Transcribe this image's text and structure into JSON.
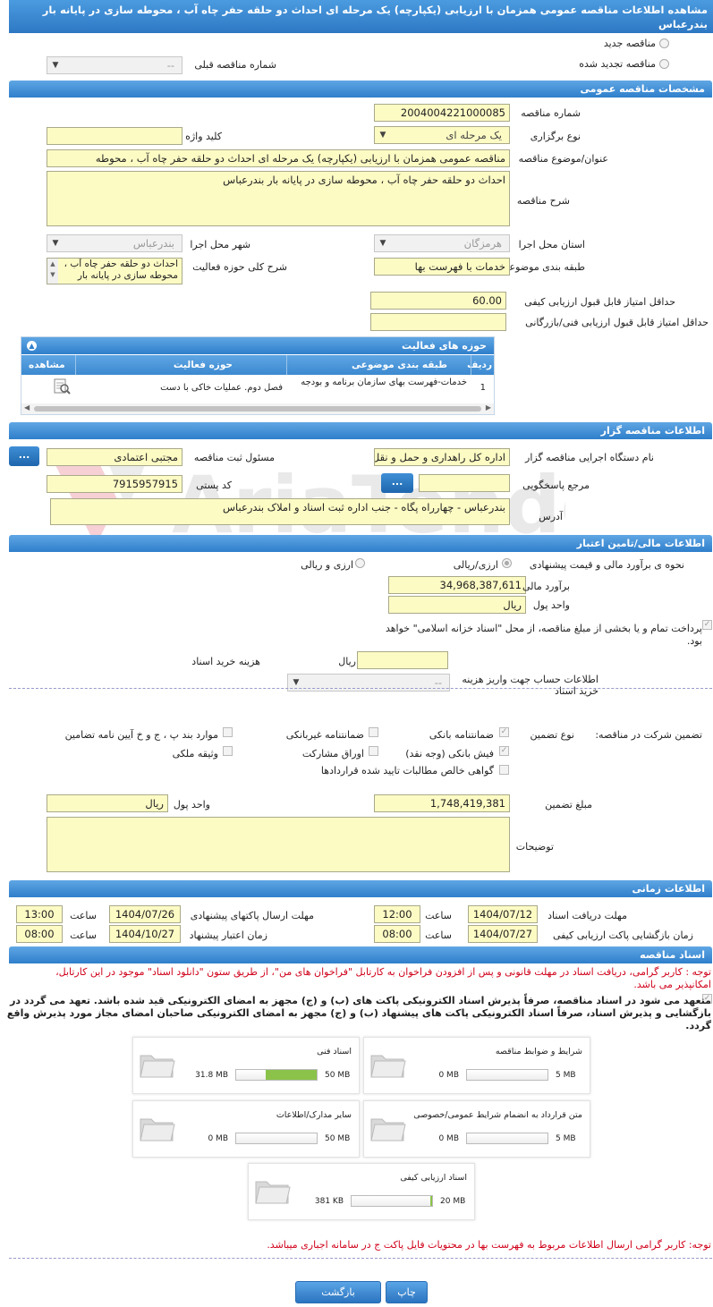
{
  "title": "مشاهده اطلاعات مناقصه عمومی همزمان با ارزیابی (یکپارچه) یک مرحله ای احداث دو حلقه حفر چاه آب ، محوطه سازی در پایانه بار بندرعباس",
  "header": {
    "radio_new": "مناقصه جدید",
    "radio_renewed": "مناقصه تجدید شده",
    "prev_number_label": "شماره مناقصه قبلی",
    "prev_number_value": "--"
  },
  "general": {
    "section_title": "مشخصات مناقصه عمومی",
    "number_label": "شماره مناقصه",
    "number_value": "2004004221000085",
    "type_label": "نوع برگزاری",
    "type_value": "یک مرحله ای",
    "keyword_label": "کلید واژه",
    "keyword_value": "",
    "subject_label": "عنوان/موضوع مناقصه",
    "subject_value": "مناقصه عمومی همزمان با ارزیابی (یکپارچه) یک مرحله ای احداث دو حلقه حفر چاه آب ، محوطه",
    "desc_label": "شرح مناقصه",
    "desc_value": "احداث دو حلقه حفر چاه آب ، محوطه سازی در پایانه بار بندرعباس",
    "province_label": "استان محل اجرا",
    "province_value": "هرمزگان",
    "city_label": "شهر محل اجرا",
    "city_value": "بندرعباس",
    "category_label": "طبقه بندی موضوعی",
    "category_value": "خدمات با فهرست بها",
    "scope_label": "شرح کلی حوزه فعالیت",
    "scope_value": "احداث دو حلقه حفر چاه آب ، محوطه سازی در پایانه بار",
    "min_quality_label": "حداقل امتیاز قابل قبول ارزیابی کیفی",
    "min_quality_value": "60.00",
    "min_tech_label": "حداقل امتیاز قابل قبول ارزیابی فنی/بازرگانی",
    "min_tech_value": ""
  },
  "activity": {
    "title": "حوزه های فعالیت",
    "columns": [
      "ردیف",
      "طبقه بندی موضوعی",
      "حوزه فعالیت",
      "مشاهده"
    ],
    "rows": [
      {
        "num": "1",
        "category": "خدمات-فهرست بهای سازمان برنامه و بودجه",
        "field": "فصل دوم. عملیات خاکی با دست"
      }
    ]
  },
  "organizer": {
    "section_title": "اطلاعات مناقصه گزار",
    "org_label": "نام دستگاه اجرایی مناقصه گزار",
    "org_value": "اداره کل راهداری و حمل و نقل",
    "resp_label": "مسئول ثبت مناقصه",
    "resp_value": "مجتبی اعتمادی",
    "btn_dots": "...",
    "ref_label": "مرجع پاسخگویی",
    "ref_value": "",
    "postal_label": "کد پستی",
    "postal_value": "7915957915",
    "address_label": "آدرس",
    "address_value": "بندرعباس - چهارراه پگاه - جنب اداره ثبت اسناد و املاک بندرعباس"
  },
  "finance": {
    "section_title": "اطلاعات مالی/تامین اعتبار",
    "estimate_method_label": "نحوه ی برآورد مالی و قیمت پیشنهادی",
    "opt_currency": "ارزی/ریالی",
    "opt_currency2": "ارزی و ریالی",
    "estimate_label": "برآورد مالی",
    "estimate_value": "34,968,387,611",
    "unit_label": "واحد پول",
    "unit_value": "ریال",
    "payment_text": "پرداخت تمام و یا بخشی از مبلغ مناقصه، از محل \"اسناد خزانه اسلامی\" خواهد بود.",
    "doc_cost_label": "هزینه خرید اسناد",
    "doc_cost_unit": "ریال",
    "account_label": "اطلاعات حساب جهت واریز هزینه خرید اسناد",
    "account_value": "--"
  },
  "guarantee": {
    "label": "تضمین شرکت در مناقصه:",
    "type_label": "نوع تضمین",
    "options": {
      "bank": "ضمانتنامه بانکی",
      "nonbank": "ضمانتنامه غیربانکی",
      "items": "موارد بند پ ، ج و خ آیین نامه تضامین",
      "cash": "فیش بانکی (وجه نقد)",
      "bonds": "اوراق مشارکت",
      "property": "وثیقه ملکی",
      "cert": "گواهی خالص مطالبات تایید شده قراردادها"
    },
    "amount_label": "مبلغ تضمین",
    "amount_value": "1,748,419,381",
    "unit_label": "واحد پول",
    "unit_value": "ریال",
    "notes_label": "توضیحات"
  },
  "timing": {
    "section_title": "اطلاعات زمانی",
    "doc_deadline_label": "مهلت دریافت اسناد",
    "doc_deadline_date": "1404/07/12",
    "doc_deadline_time": "12:00",
    "send_deadline_label": "مهلت ارسال پاکتهای پیشنهادی",
    "send_deadline_date": "1404/07/26",
    "send_deadline_time": "13:00",
    "open_label": "زمان بازگشایی پاکت ارزیابی کیفی",
    "open_date": "1404/07/27",
    "open_time": "08:00",
    "validity_label": "زمان اعتبار پیشنهاد",
    "validity_date": "1404/10/27",
    "validity_time": "08:00",
    "time_label": "ساعت"
  },
  "documents": {
    "section_title": "اسناد مناقصه",
    "notice": "توجه : کاربر گرامی، دریافت اسناد در مهلت قانونی و پس از افزودن فراخوان به کارتابل \"فراخوان های من\"، از طریق ستون \"دانلود اسناد\" موجود در این کارتابل، امکانپذیر می باشد.",
    "commit": "متعهد می شود در اسناد مناقصه، صرفاً پذیرش اسناد الکترونیکی پاکت های (ب) و (ج) مجهز به امضای الکترونیکی قید شده باشد. تعهد می گردد در بازگشایی و پذیرش اسناد، صرفاً اسناد الکترونیکی پاکت های پیشنهاد (ب) و (ج) مجهز به امضای الکترونیکی صاحبان امضای مجاز مورد پذیرش واقع گردد.",
    "files": [
      {
        "name": "شرایط و ضوابط مناقصه",
        "current": "0 MB",
        "max": "5 MB",
        "fill": 0
      },
      {
        "name": "اسناد فنی",
        "current": "31.8 MB",
        "max": "50 MB",
        "fill": 0.636
      },
      {
        "name": "متن قرارداد به انضمام شرایط عمومی/خصوصی",
        "current": "0 MB",
        "max": "5 MB",
        "fill": 0
      },
      {
        "name": "سایر مدارک/اطلاعات",
        "current": "0 MB",
        "max": "50 MB",
        "fill": 0
      },
      {
        "name": "اسناد ارزیابی کیفی",
        "current": "381 KB",
        "max": "20 MB",
        "fill": 0.02
      }
    ],
    "footer_notice": "توجه: کاربر گرامی ارسال اطلاعات مربوط به فهرست بها در محتویات فایل پاکت ج در سامانه اجباری میباشد."
  },
  "buttons": {
    "back": "بازگشت",
    "print": "چاپ"
  },
  "watermark": "AriaTender.net"
}
